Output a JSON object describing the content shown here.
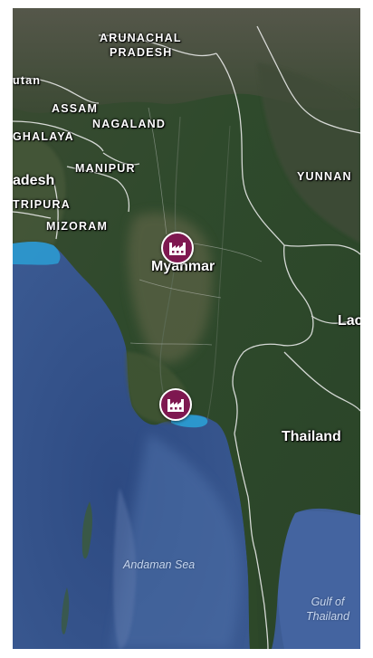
{
  "map": {
    "regions": {
      "arunachal_line1": "ARUNACHAL",
      "arunachal_line2": "PRADESH",
      "bhutan": "utan",
      "assam": "ASSAM",
      "nagaland": "NAGALAND",
      "meghalaya": "GHALAYA",
      "bangladesh": "adesh",
      "manipur": "MANIPUR",
      "tripura": "TRIPURA",
      "mizoram": "MIZORAM",
      "yunnan": "YUNNAN"
    },
    "countries": {
      "myanmar": "Myanmar",
      "thailand": "Thailand",
      "laos": "Lac"
    },
    "water": {
      "andaman_sea": "Andaman Sea",
      "gulf_line1": "Gulf of",
      "gulf_line2": "Thailand"
    },
    "markers": [
      {
        "name": "factory-marker-myanmar",
        "icon": "factory-icon",
        "color": "#7e1850"
      },
      {
        "name": "factory-marker-yangon",
        "icon": "factory-icon",
        "color": "#7e1850"
      }
    ]
  }
}
